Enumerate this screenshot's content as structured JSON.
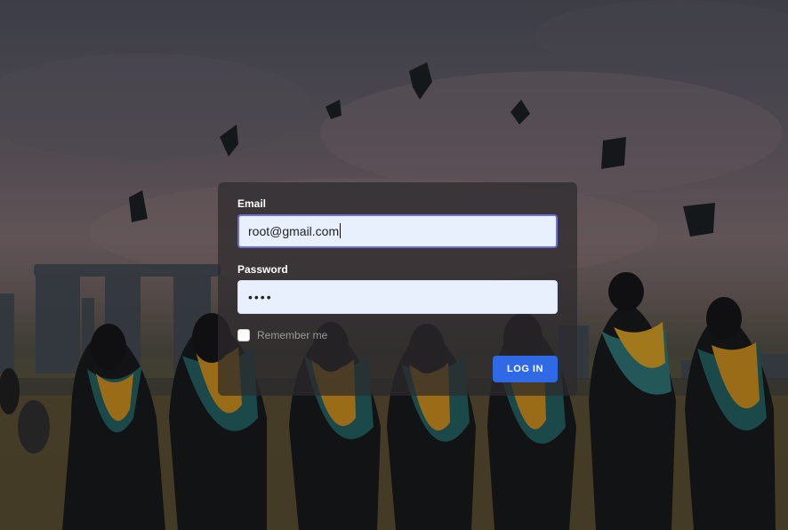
{
  "login_form": {
    "email_label": "Email",
    "email_value": "root@gmail.com",
    "password_label": "Password",
    "password_value": "••••",
    "remember_label": "Remember me",
    "remember_checked": false,
    "login_button_label": "LOG IN"
  },
  "colors": {
    "button": "#2f69e6",
    "input_background": "#e8f0fe",
    "focus_border": "#6e6fd6",
    "card_background": "rgba(45,42,44,0.72)"
  },
  "background": {
    "description_icon": "graduation-photo"
  }
}
